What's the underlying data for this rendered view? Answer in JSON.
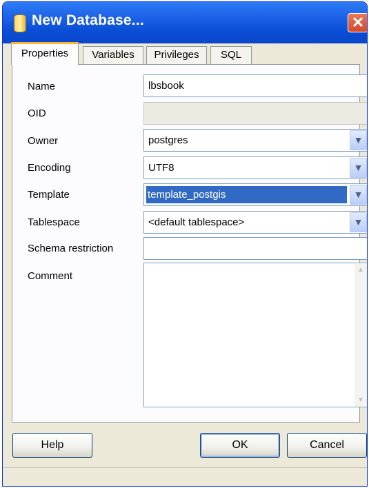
{
  "window": {
    "title": "New Database...",
    "close_glyph": "✕",
    "title_icon": "database-icon"
  },
  "tabs": [
    {
      "label": "Properties",
      "active": true
    },
    {
      "label": "Variables",
      "active": false
    },
    {
      "label": "Privileges",
      "active": false
    },
    {
      "label": "SQL",
      "active": false
    }
  ],
  "form": {
    "name": {
      "label": "Name",
      "value": "lbsbook"
    },
    "oid": {
      "label": "OID",
      "value": ""
    },
    "owner": {
      "label": "Owner",
      "value": "postgres"
    },
    "encoding": {
      "label": "Encoding",
      "value": "UTF8"
    },
    "template": {
      "label": "Template",
      "value": "template_postgis"
    },
    "tablespace": {
      "label": "Tablespace",
      "value": "<default tablespace>"
    },
    "schema_restriction": {
      "label": "Schema restriction",
      "value": ""
    },
    "comment": {
      "label": "Comment",
      "value": ""
    }
  },
  "dropdown_glyph": "▼",
  "scroll": {
    "up_glyph": "▲",
    "down_glyph": "▼"
  },
  "buttons": {
    "help": "Help",
    "ok": "OK",
    "cancel": "Cancel"
  },
  "colors": {
    "titlebar": "#0a4ed6",
    "selection": "#316ac5",
    "active_tab_accent": "#f7b63a"
  }
}
